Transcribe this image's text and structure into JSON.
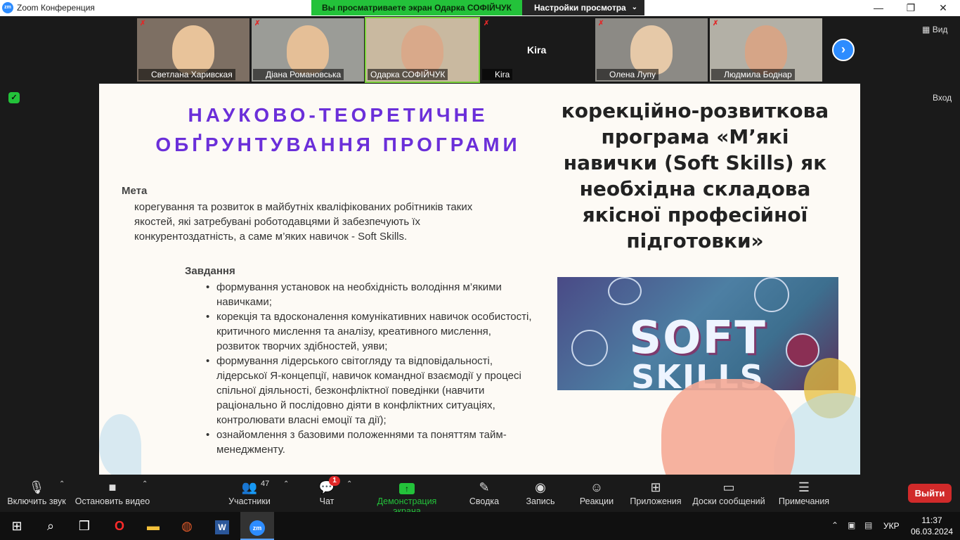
{
  "window": {
    "logo": "zm",
    "title": "Zoom Конференция",
    "share_banner": "Вы просматриваете экран Одарка СОФІЙЧУК",
    "view_options": "Настройки просмотра",
    "minimize_icon": "minimize-icon",
    "maximize_icon": "restore-icon",
    "close_icon": "close-icon"
  },
  "participants_strip": [
    {
      "name": "Светлана Харивская",
      "muted": true
    },
    {
      "name": "Діана Романовська",
      "muted": true
    },
    {
      "name": "Одарка СОФІЙЧУК",
      "muted": false,
      "active_speaker": true
    },
    {
      "name": "Kira",
      "muted": true,
      "video": false
    },
    {
      "name": "Олена Лупу",
      "muted": true
    },
    {
      "name": "Людмила Боднар",
      "muted": true
    }
  ],
  "kira_center": "Kira",
  "view_button": "Вид",
  "enter_label": "Вход",
  "slide": {
    "heading": "НАУКОВО-ТЕОРЕТИЧНЕ ОБҐРУНТУВАННЯ ПРОГРАМИ",
    "subtitle": "корекційно-розвиткова програма «М’які навички (Soft Skills) як необхідна складова якісної професійної підготовки»",
    "goal_label": "Мета",
    "goal_text": "корегування та розвиток в майбутніх кваліфікованих робітників таких якостей, які затребувані роботодавцями й забезпечують їх конкурентоздатність, а саме м’яких навичок - Soft Skills.",
    "tasks_label": "Завдання",
    "tasks": [
      "формування установок на необхідність володіння м’якими навичками;",
      "корекція та вдосконалення комунікативних навичок особистості, критичного мислення та аналізу, креативного мислення, розвиток творчих здібностей, уяви;",
      "формування лідерського світогляду та відповідальності, лідерської Я-концепції, навичок командної взаємодії у процесі спільної діяльності, безконфліктної поведінки (навчити раціонально й послідовно діяти в конфліктних ситуаціях, контролювати власні емоції та дії);",
      "ознайомлення з базовими положеннями та поняттям тайм-менеджменту."
    ],
    "banner_line1": "SOFT",
    "banner_line2": "SKILLS"
  },
  "toolbar": {
    "mute": "Включить звук",
    "video": "Остановить видео",
    "participants": "Участники",
    "participants_count": "47",
    "chat": "Чат",
    "chat_badge": "1",
    "share": "Демонстрация экрана",
    "summary": "Сводка",
    "record": "Запись",
    "reactions": "Реакции",
    "apps": "Приложения",
    "whiteboards": "Доски сообщений",
    "notes": "Примечания",
    "leave": "Выйти"
  },
  "taskbar": {
    "lang": "УКР",
    "time": "11:37",
    "date": "06.03.2024"
  },
  "colors": {
    "share_green": "#23c23a",
    "zoom_blue": "#2d8cff",
    "leave_red": "#d12a2a",
    "heading_purple": "#6b2fd9"
  }
}
